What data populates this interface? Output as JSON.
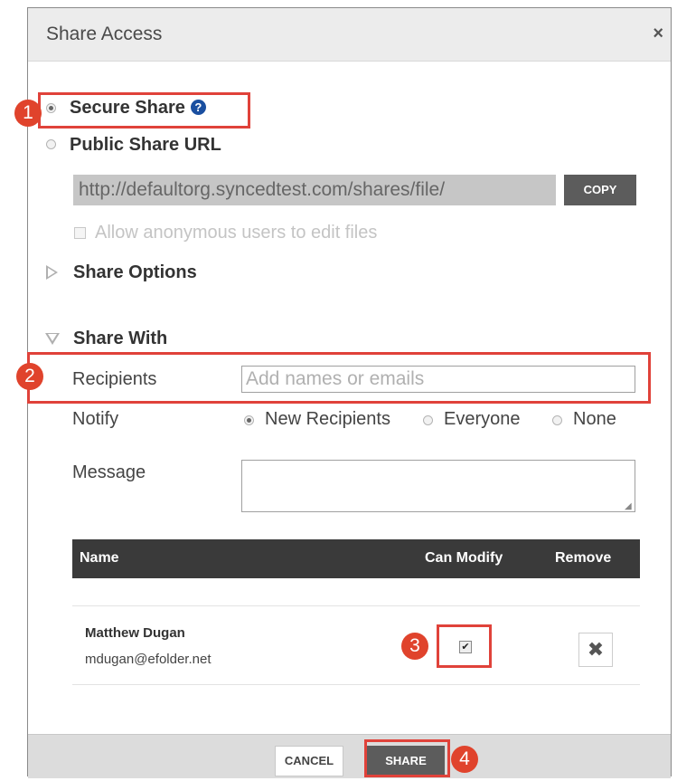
{
  "dialog": {
    "title": "Share Access",
    "close_glyph": "×"
  },
  "share_type": {
    "secure_label": "Secure Share",
    "secure_selected": true,
    "help_glyph": "?",
    "public_label": "Public Share URL",
    "public_selected": false
  },
  "public_url": {
    "value": "http://defaultorg.syncedtest.com/shares/file/",
    "copy_label": "COPY",
    "allow_anonymous_label": "Allow anonymous users to edit files",
    "allow_anonymous_checked": false
  },
  "share_options": {
    "label": "Share Options",
    "expanded": false
  },
  "share_with": {
    "label": "Share With",
    "expanded": true,
    "recipients_label": "Recipients",
    "recipients_placeholder": "Add names or emails",
    "notify_label": "Notify",
    "notify_options": [
      "New Recipients",
      "Everyone",
      "None"
    ],
    "notify_selected": "New Recipients",
    "message_label": "Message"
  },
  "table": {
    "columns": [
      "Name",
      "Can Modify",
      "Remove"
    ],
    "rows": [
      {
        "name": "Matthew Dugan",
        "email": "mdugan@efolder.net",
        "can_modify": true,
        "remove_glyph": "✖"
      }
    ]
  },
  "footer": {
    "cancel_label": "CANCEL",
    "share_label": "SHARE"
  },
  "annotations": {
    "steps": [
      "1",
      "2",
      "3",
      "4"
    ],
    "color": "#e0423a"
  }
}
